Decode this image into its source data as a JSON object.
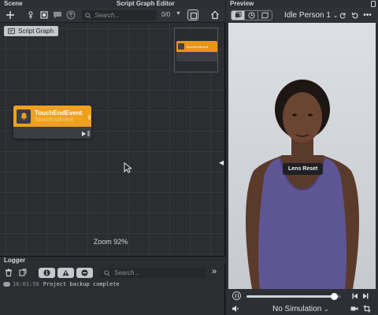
{
  "editor": {
    "scene_label": "Scene",
    "title": "Script Graph Editor",
    "search_placeholder": "Search...",
    "count": "0/0",
    "chip_label": "Script Graph",
    "node": {
      "title": "TouchEndEvent",
      "subtitle": "TouchEndEvent"
    },
    "minimap_node_title": "TouchEndEvent",
    "zoom_label": "Zoom 92%"
  },
  "logger": {
    "title": "Logger",
    "search_placeholder": "Search...",
    "entries": [
      {
        "time": "16:01:58",
        "message": "Project backup complete"
      }
    ]
  },
  "preview": {
    "title": "Preview",
    "person_select": "Idle Person 1",
    "lens_badge": "Lens Reset",
    "simulation_select": "No Simulation",
    "progress_fraction": 0.93
  },
  "colors": {
    "node_accent": "#f0a01f",
    "panel_bg": "#2b2d31",
    "video_bg": "#d3d6da"
  },
  "icons": [
    "plus-icon",
    "touch-icon",
    "frame-icon",
    "comment-icon",
    "arrow-up-icon",
    "search-icon",
    "home-icon",
    "bell-icon",
    "trash-icon",
    "clear-icon",
    "info-icon",
    "warning-icon",
    "error-icon",
    "chevrons-right-icon",
    "pause-icon",
    "camera-icon",
    "crop-icon",
    "volume-icon",
    "refresh-icon",
    "reset-icon",
    "more-icon"
  ]
}
